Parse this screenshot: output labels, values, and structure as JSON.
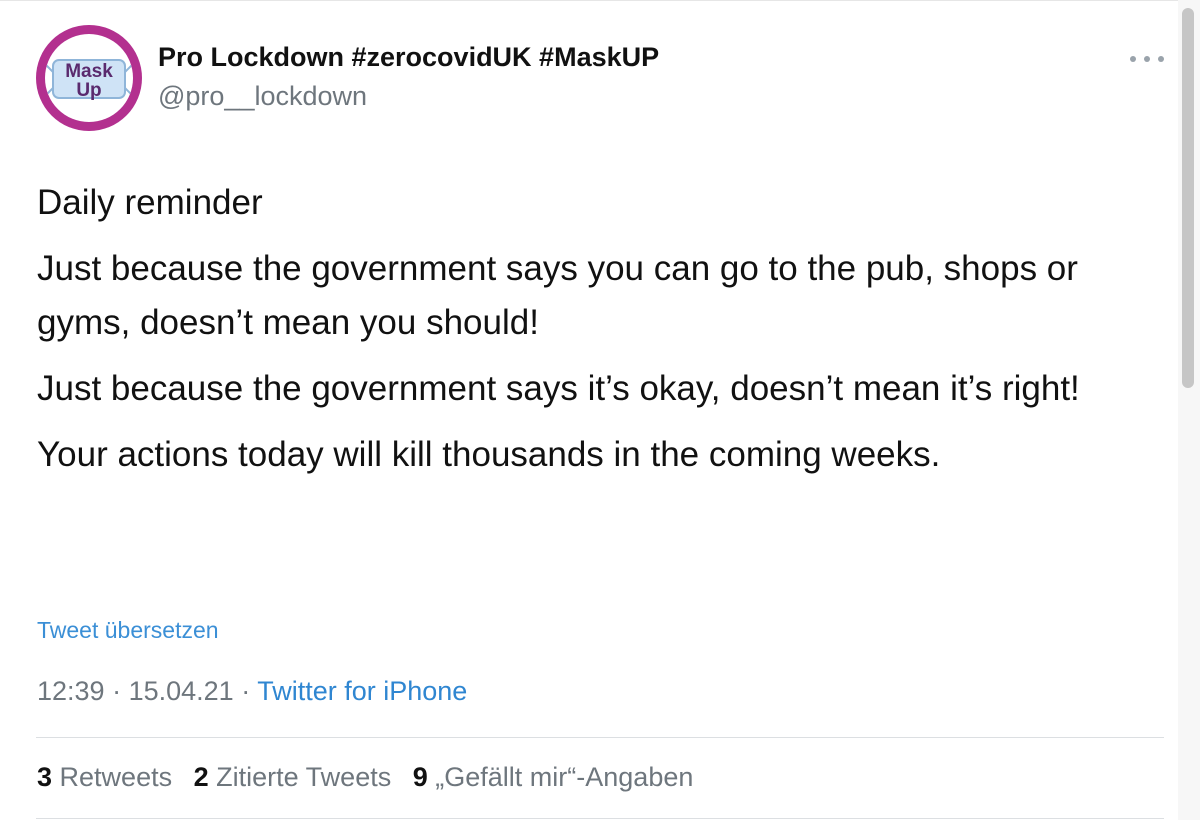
{
  "author": {
    "name": "Pro Lockdown #zerocovidUK #MaskUP",
    "handle": "@pro__lockdown",
    "avatar_text": "Mask Up",
    "avatar_ring_color": "#b3308f"
  },
  "menu_icon": "more-horizontal-icon",
  "tweet": {
    "paragraphs": [
      "Daily reminder",
      "Just because the government says you can go to the pub, shops or gyms, doesn’t mean you should!",
      "Just because the government says it’s okay, doesn’t mean it’s right!",
      "Your actions today will kill thousands in the coming weeks."
    ]
  },
  "translate_label": "Tweet übersetzen",
  "meta": {
    "time": "12:39",
    "separator": " · ",
    "date": "15.04.21",
    "source": "Twitter for iPhone"
  },
  "stats": {
    "retweets_count": "3",
    "retweets_label": " Retweets",
    "quotes_count": "2",
    "quotes_label": " Zitierte Tweets",
    "likes_count": "9",
    "likes_label": " „Gefällt mir“-Angaben"
  },
  "colors": {
    "link": "#3b8fd6",
    "secondary_text": "#6e767d",
    "primary_text": "#111111"
  }
}
